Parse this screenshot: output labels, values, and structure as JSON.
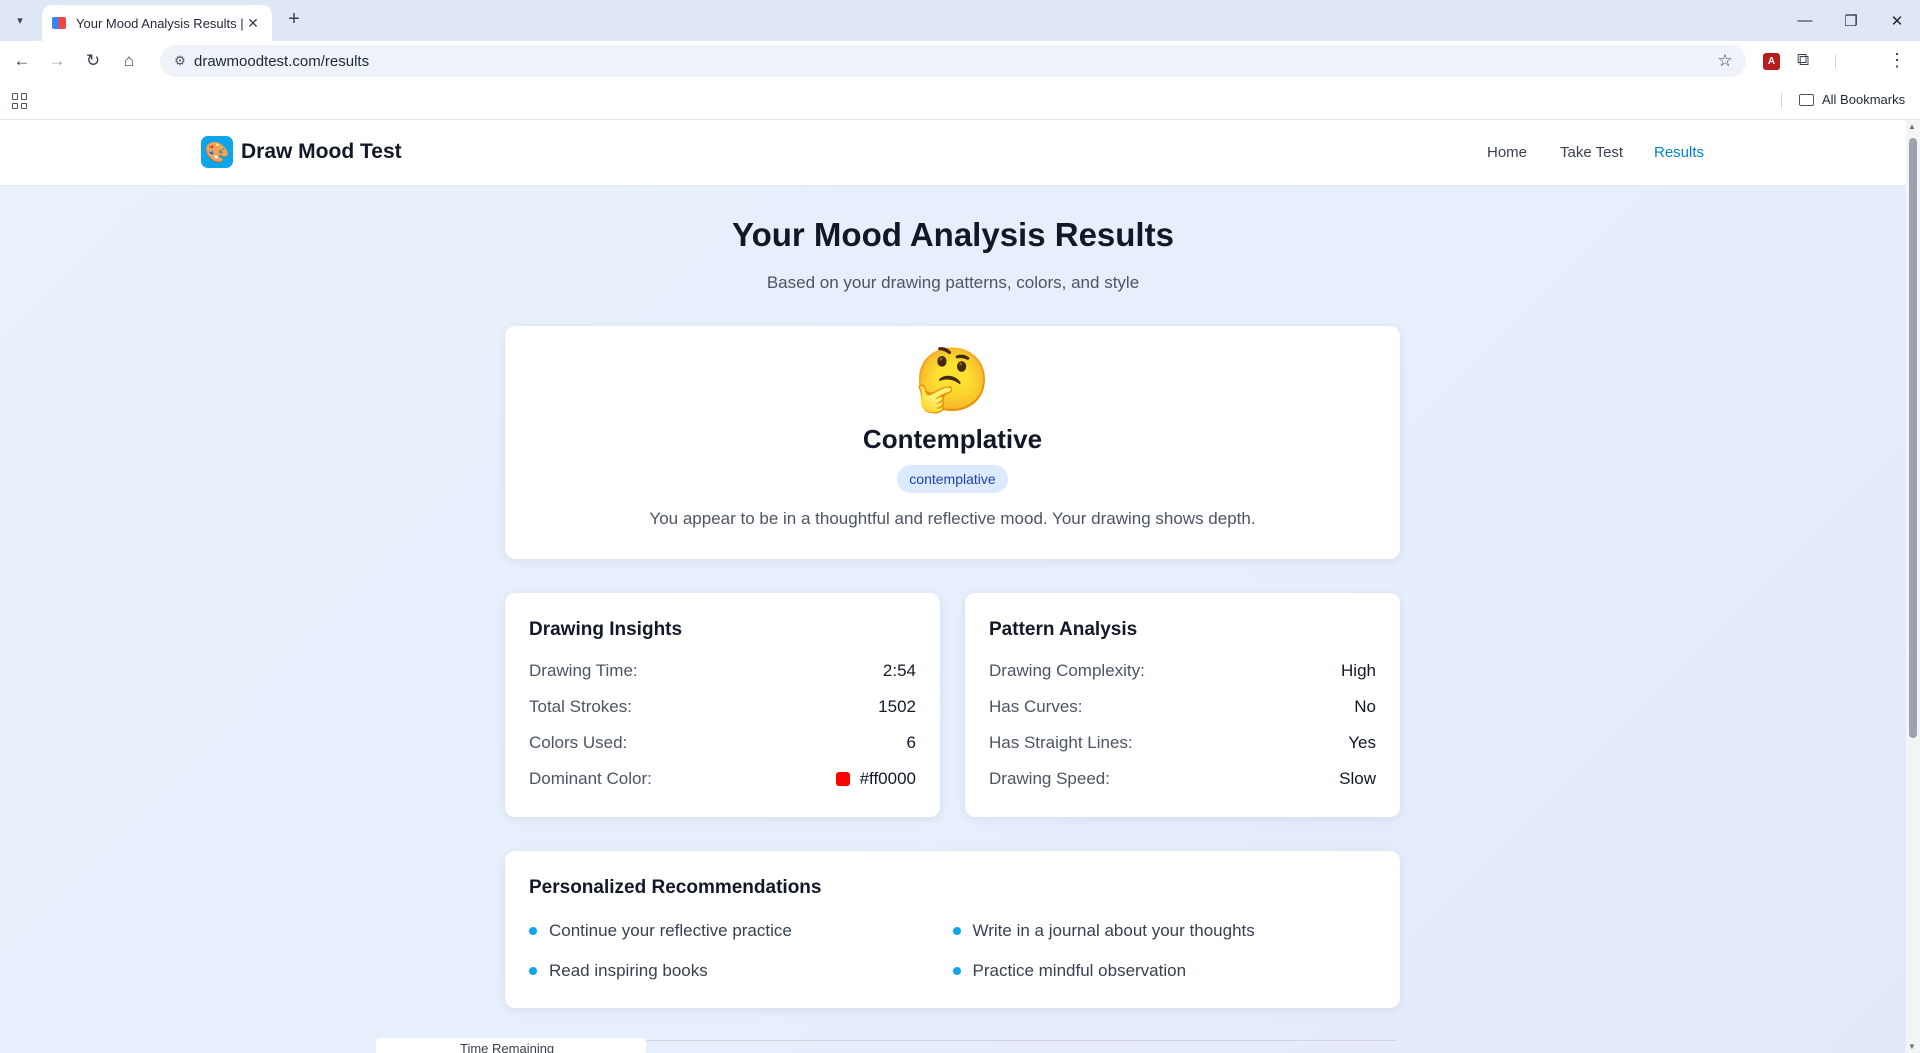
{
  "browser": {
    "tab_title": "Your Mood Analysis Results |",
    "url": "drawmoodtest.com/results",
    "all_bookmarks": "All Bookmarks"
  },
  "site": {
    "brand": "Draw Mood Test",
    "nav": [
      "Home",
      "Take Test",
      "Results"
    ],
    "active_nav": "Results"
  },
  "results": {
    "title": "Your Mood Analysis Results",
    "subtitle": "Based on your drawing patterns, colors, and style",
    "mood_emoji": "🤔",
    "mood_name": "Contemplative",
    "mood_tag": "contemplative",
    "mood_description": "You appear to be in a thoughtful and reflective mood. Your drawing shows depth."
  },
  "drawing_insights": {
    "heading": "Drawing Insights",
    "rows": [
      {
        "label": "Drawing Time:",
        "value": "2:54"
      },
      {
        "label": "Total Strokes:",
        "value": "1502"
      },
      {
        "label": "Colors Used:",
        "value": "6"
      },
      {
        "label": "Dominant Color:",
        "value": "#ff0000"
      }
    ],
    "dominant_color": "#ff0000"
  },
  "pattern_analysis": {
    "heading": "Pattern Analysis",
    "rows": [
      {
        "label": "Drawing Complexity:",
        "value": "High"
      },
      {
        "label": "Has Curves:",
        "value": "No"
      },
      {
        "label": "Has Straight Lines:",
        "value": "Yes"
      },
      {
        "label": "Drawing Speed:",
        "value": "Slow"
      }
    ]
  },
  "recommendations": {
    "heading": "Personalized Recommendations",
    "items": [
      "Continue your reflective practice",
      "Write in a journal about your thoughts",
      "Read inspiring books",
      "Practice mindful observation"
    ]
  },
  "peek_text": "Time Remaining",
  "colors": {
    "accent": "#0ea5e9",
    "active_nav": "#0284c7",
    "tag_bg": "#dbeafe",
    "tag_text": "#1e40af"
  }
}
